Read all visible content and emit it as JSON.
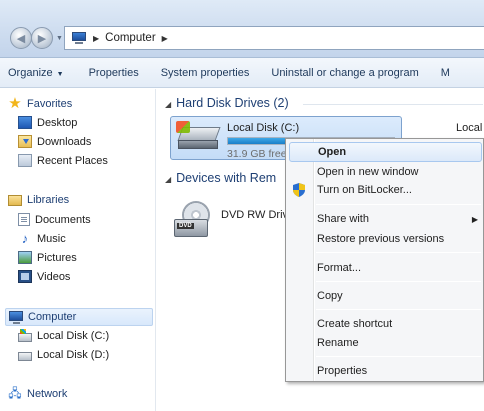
{
  "address": {
    "crumbs": [
      "Computer"
    ]
  },
  "toolbar": {
    "organize": "Organize",
    "properties": "Properties",
    "system_properties": "System properties",
    "uninstall": "Uninstall or change a program",
    "overflow": "M"
  },
  "navpane": {
    "favorites": "Favorites",
    "desktop": "Desktop",
    "downloads": "Downloads",
    "recent_places": "Recent Places",
    "libraries": "Libraries",
    "documents": "Documents",
    "music": "Music",
    "pictures": "Pictures",
    "videos": "Videos",
    "computer": "Computer",
    "local_c": "Local Disk (C:)",
    "local_d": "Local Disk (D:)",
    "network": "Network"
  },
  "content": {
    "hdd_group": "Hard Disk Drives (2)",
    "removable_group": "Devices with Rem",
    "drive_c": {
      "name": "Local Disk (C:)",
      "free_text": "31.9 GB free",
      "used_fraction": 0.38
    },
    "right_peek": "Local",
    "dvd": {
      "name": "DVD RW Driv",
      "icon_text": "DVD"
    }
  },
  "context_menu": {
    "open": "Open",
    "open_new_window": "Open in new window",
    "bitlocker": "Turn on BitLocker...",
    "share_with": "Share with",
    "restore": "Restore previous versions",
    "format": "Format...",
    "copy": "Copy",
    "create_shortcut": "Create shortcut",
    "rename": "Rename",
    "properties": "Properties"
  }
}
